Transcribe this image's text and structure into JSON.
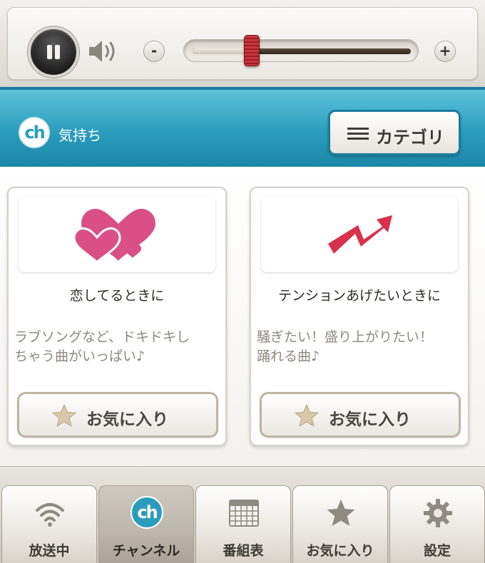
{
  "player": {
    "volume_minus": "-",
    "volume_plus": "+",
    "volume_level_percent": 27
  },
  "header": {
    "logo_text": "ch",
    "title": "気持ち",
    "category_button": "カテゴリ"
  },
  "cards": [
    {
      "title": "恋してるときに",
      "desc_line1": "ラブソングなど、ドキドキし",
      "desc_line2": "ちゃう曲がいっぱい♪",
      "favorite_label": "お気に入り"
    },
    {
      "title": "テンションあげたいときに",
      "desc_line1": "騒ぎたい！盛り上がりたい！",
      "desc_line2": "踊れる曲♪",
      "favorite_label": "お気に入り"
    }
  ],
  "tabs": [
    {
      "label": "放送中",
      "icon": "wifi-icon"
    },
    {
      "label": "チャンネル",
      "icon": "channel-icon",
      "logo_text": "ch",
      "active": true
    },
    {
      "label": "番組表",
      "icon": "schedule-grid-icon"
    },
    {
      "label": "お気に入り",
      "icon": "star-icon"
    },
    {
      "label": "設定",
      "icon": "gear-icon"
    }
  ],
  "colors": {
    "header_blue": "#2a9dbd",
    "heart_pink": "#d94f86",
    "arrow_red": "#d8314b",
    "slider_thumb_red": "#c9363e"
  }
}
